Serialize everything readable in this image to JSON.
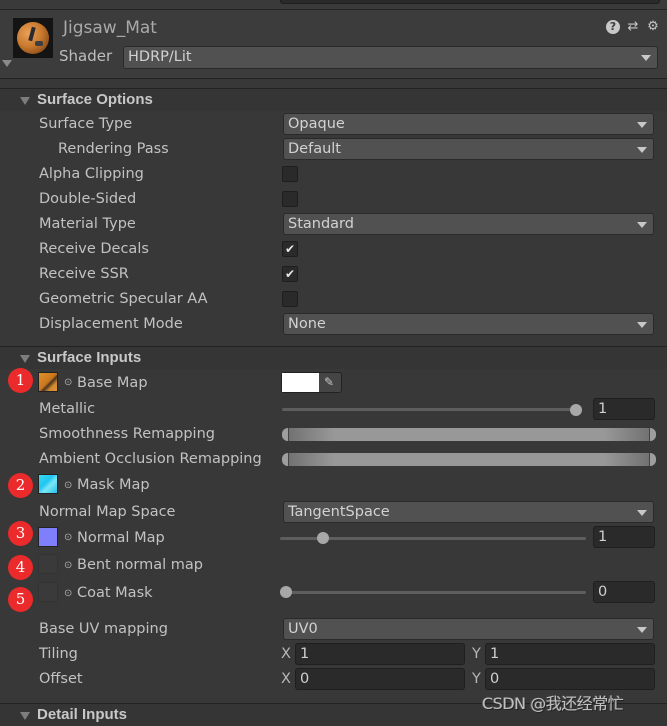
{
  "header": {
    "material_name": "Jigsaw_Mat",
    "shader_label": "Shader",
    "shader_value": "HDRP/Lit",
    "icons": [
      "help-icon",
      "presets-icon",
      "settings-gear-icon"
    ]
  },
  "surface_options": {
    "title": "Surface Options",
    "rows": [
      {
        "label": "Surface Type",
        "type": "dropdown",
        "value": "Opaque"
      },
      {
        "label": "Rendering Pass",
        "type": "dropdown",
        "value": "Default"
      },
      {
        "label": "Alpha Clipping",
        "type": "checkbox",
        "checked": false
      },
      {
        "label": "Double-Sided",
        "type": "checkbox",
        "checked": false
      },
      {
        "label": "Material Type",
        "type": "dropdown",
        "value": "Standard"
      },
      {
        "label": "Receive Decals",
        "type": "checkbox",
        "checked": true
      },
      {
        "label": "Receive SSR",
        "type": "checkbox",
        "checked": true
      },
      {
        "label": "Geometric Specular AA",
        "type": "checkbox",
        "checked": false
      },
      {
        "label": "Displacement Mode",
        "type": "dropdown",
        "value": "None"
      }
    ]
  },
  "surface_inputs": {
    "title": "Surface Inputs",
    "base_map": {
      "badge": "1",
      "label": "Base Map",
      "color": "#ffffff"
    },
    "metallic": {
      "label": "Metallic",
      "value": "1",
      "fraction": 1.0
    },
    "smoothness_remapping": {
      "label": "Smoothness Remapping",
      "min": 0,
      "max": 1
    },
    "ao_remapping": {
      "label": "Ambient Occlusion Remapping",
      "min": 0,
      "max": 1
    },
    "mask_map": {
      "badge": "2",
      "label": "Mask Map"
    },
    "normal_map_space": {
      "label": "Normal Map Space",
      "value": "TangentSpace"
    },
    "normal_map": {
      "badge": "3",
      "label": "Normal Map",
      "value": "1",
      "fraction": 0.125
    },
    "bent_normal_map": {
      "badge": "4",
      "label": "Bent normal map"
    },
    "coat_mask": {
      "badge": "5",
      "label": "Coat Mask",
      "value": "0",
      "fraction": 0.0
    },
    "base_uv_mapping": {
      "label": "Base UV mapping",
      "value": "UV0"
    },
    "tiling": {
      "label": "Tiling",
      "x_label": "X",
      "x": "1",
      "y_label": "Y",
      "y": "1"
    },
    "offset": {
      "label": "Offset",
      "x_label": "X",
      "x": "0",
      "y_label": "Y",
      "y": "0"
    }
  },
  "detail_inputs": {
    "title": "Detail Inputs"
  },
  "watermark": "CSDN @我还经常忙"
}
